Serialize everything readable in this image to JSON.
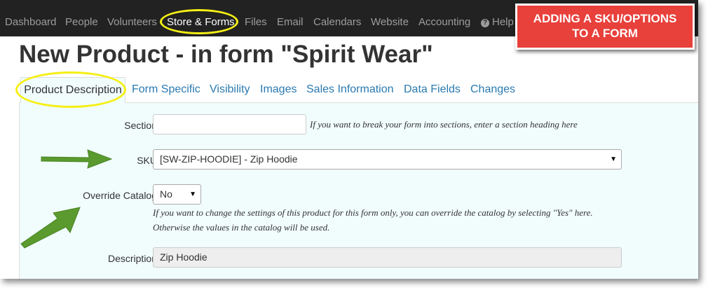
{
  "nav": {
    "items": [
      "Dashboard",
      "People",
      "Volunteers",
      "Store & Forms",
      "Files",
      "Email",
      "Calendars",
      "Website",
      "Accounting",
      "Help"
    ],
    "active": "Store & Forms"
  },
  "callout": {
    "line1": "ADDING A SKU/OPTIONS",
    "line2": "TO A FORM"
  },
  "page": {
    "title": "New Product - in form \"Spirit Wear\""
  },
  "tabs": [
    "Product Description",
    "Form Specific",
    "Visibility",
    "Images",
    "Sales Information",
    "Data Fields",
    "Changes"
  ],
  "form": {
    "section": {
      "label": "Section",
      "value": "",
      "help": "If you want to break your form into sections, enter a section heading here"
    },
    "sku": {
      "label": "SKU",
      "value": "[SW-ZIP-HOODIE] - Zip Hoodie"
    },
    "override": {
      "label": "Override Catalog",
      "value": "No",
      "help_line1": "If you want to change the settings of this product for this form only, you can override the catalog by selecting \"Yes\" here.",
      "help_line2": "Otherwise the values in the catalog will be used."
    },
    "description": {
      "label": "Description",
      "value": "Zip Hoodie"
    }
  },
  "colors": {
    "navbar": "#222222",
    "callout": "#e8403b",
    "highlight": "#f5ef14",
    "arrow": "#5a9a2e",
    "link": "#2a7ab0",
    "panel": "#f1fcfc"
  }
}
